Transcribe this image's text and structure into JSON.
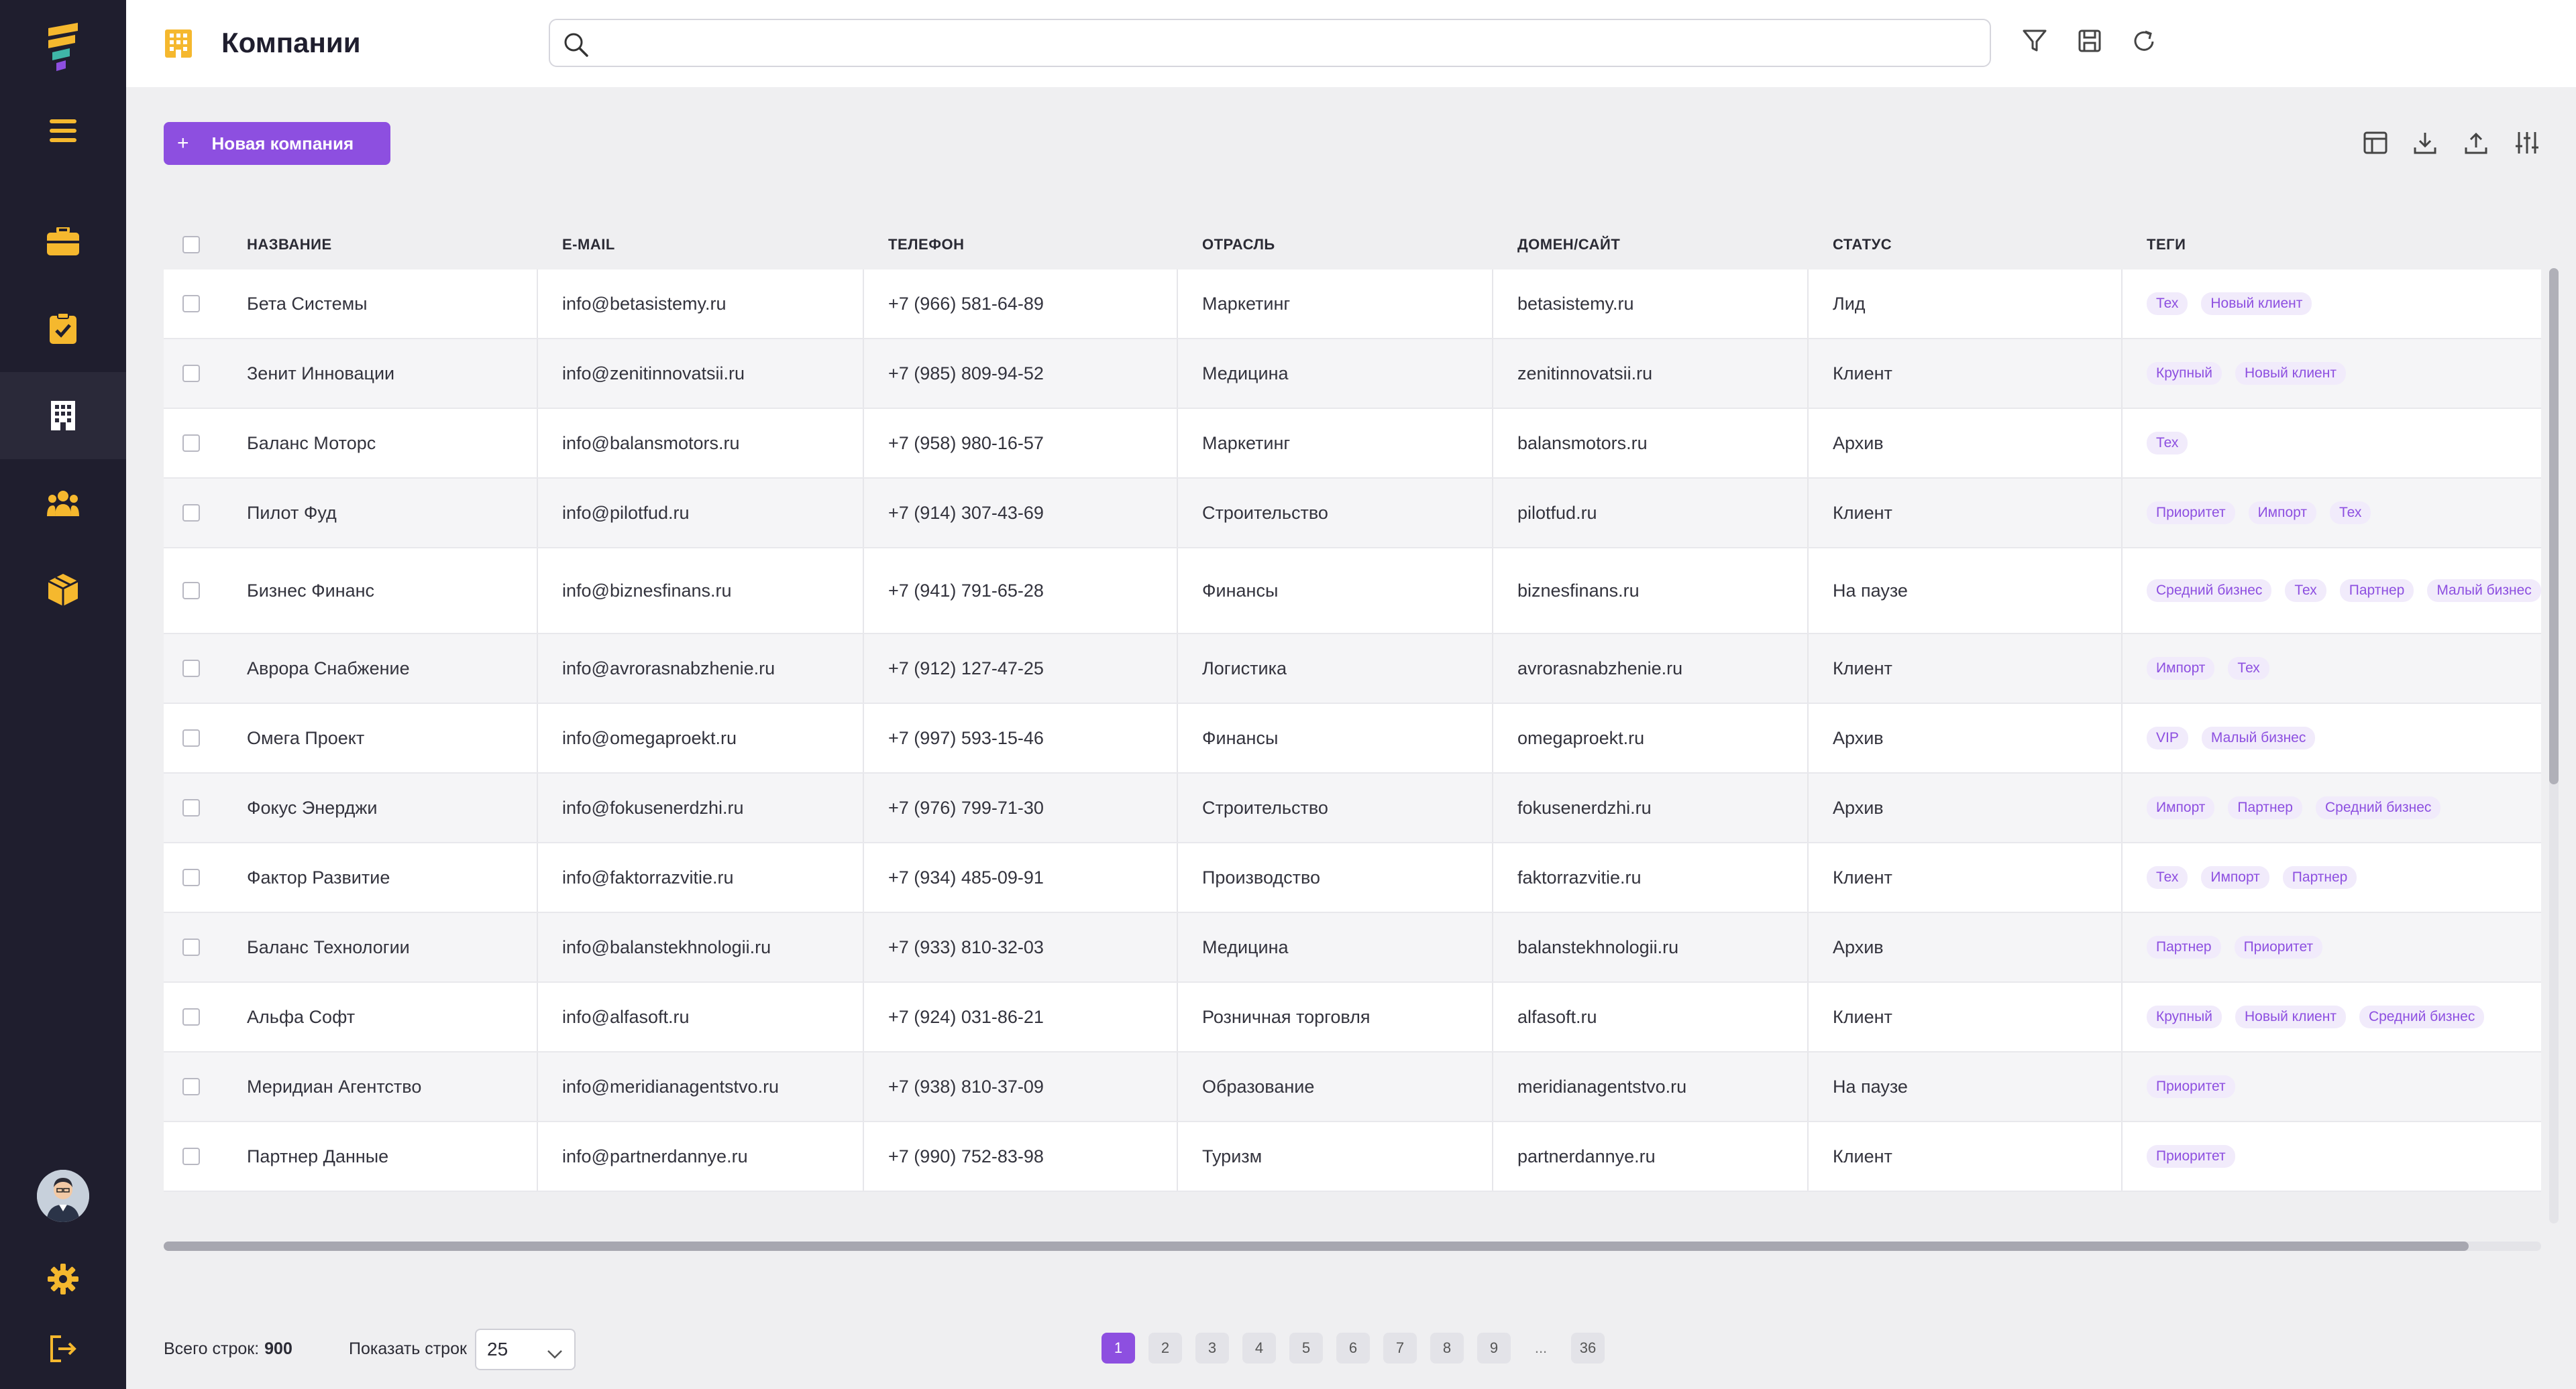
{
  "header": {
    "title": "Компании",
    "search_placeholder": ""
  },
  "toolbar": {
    "new_company_label": "Новая компания"
  },
  "table": {
    "columns": [
      "НАЗВАНИЕ",
      "E-MAIL",
      "ТЕЛЕФОН",
      "ОТРАСЛЬ",
      "ДОМЕН/САЙТ",
      "СТАТУС",
      "ТЕГИ"
    ],
    "rows": [
      {
        "name": "Бета Системы",
        "email": "info@betasistemy.ru",
        "phone": "+7 (966) 581-64-89",
        "industry": "Маркетинг",
        "domain": "betasistemy.ru",
        "status": "Лид",
        "tags": [
          "Тех",
          "Новый клиент"
        ]
      },
      {
        "name": "Зенит Инновации",
        "email": "info@zenitinnovatsii.ru",
        "phone": "+7 (985) 809-94-52",
        "industry": "Медицина",
        "domain": "zenitinnovatsii.ru",
        "status": "Клиент",
        "tags": [
          "Крупный",
          "Новый клиент"
        ]
      },
      {
        "name": "Баланс Моторс",
        "email": "info@balansmotors.ru",
        "phone": "+7 (958) 980-16-57",
        "industry": "Маркетинг",
        "domain": "balansmotors.ru",
        "status": "Архив",
        "tags": [
          "Тех"
        ]
      },
      {
        "name": "Пилот Фуд",
        "email": "info@pilotfud.ru",
        "phone": "+7 (914) 307-43-69",
        "industry": "Строительство",
        "domain": "pilotfud.ru",
        "status": "Клиент",
        "tags": [
          "Приоритет",
          "Импорт",
          "Тех"
        ]
      },
      {
        "name": "Бизнес Финанс",
        "email": "info@biznesfinans.ru",
        "phone": "+7 (941) 791-65-28",
        "industry": "Финансы",
        "domain": "biznesfinans.ru",
        "status": "На паузе",
        "tags": [
          "Средний бизнес",
          "Тех",
          "Партнер",
          "Малый бизнес"
        ]
      },
      {
        "name": "Аврора Снабжение",
        "email": "info@avrorasnabzhenie.ru",
        "phone": "+7 (912) 127-47-25",
        "industry": "Логистика",
        "domain": "avrorasnabzhenie.ru",
        "status": "Клиент",
        "tags": [
          "Импорт",
          "Тех"
        ]
      },
      {
        "name": "Омега Проект",
        "email": "info@omegaproekt.ru",
        "phone": "+7 (997) 593-15-46",
        "industry": "Финансы",
        "domain": "omegaproekt.ru",
        "status": "Архив",
        "tags": [
          "VIP",
          "Малый бизнес"
        ]
      },
      {
        "name": "Фокус Энерджи",
        "email": "info@fokusenerdzhi.ru",
        "phone": "+7 (976) 799-71-30",
        "industry": "Строительство",
        "domain": "fokusenerdzhi.ru",
        "status": "Архив",
        "tags": [
          "Импорт",
          "Партнер",
          "Средний бизнес"
        ]
      },
      {
        "name": "Фактор Развитие",
        "email": "info@faktorrazvitie.ru",
        "phone": "+7 (934) 485-09-91",
        "industry": "Производство",
        "domain": "faktorrazvitie.ru",
        "status": "Клиент",
        "tags": [
          "Тех",
          "Импорт",
          "Партнер"
        ]
      },
      {
        "name": "Баланс Технологии",
        "email": "info@balanstekhnologii.ru",
        "phone": "+7 (933) 810-32-03",
        "industry": "Медицина",
        "domain": "balanstekhnologii.ru",
        "status": "Архив",
        "tags": [
          "Партнер",
          "Приоритет"
        ]
      },
      {
        "name": "Альфа Софт",
        "email": "info@alfasoft.ru",
        "phone": "+7 (924) 031-86-21",
        "industry": "Розничная торговля",
        "domain": "alfasoft.ru",
        "status": "Клиент",
        "tags": [
          "Крупный",
          "Новый клиент",
          "Средний бизнес"
        ]
      },
      {
        "name": "Меридиан Агентство",
        "email": "info@meridianagentstvo.ru",
        "phone": "+7 (938) 810-37-09",
        "industry": "Образование",
        "domain": "meridianagentstvo.ru",
        "status": "На паузе",
        "tags": [
          "Приоритет"
        ]
      },
      {
        "name": "Партнер Данные",
        "email": "info@partnerdannye.ru",
        "phone": "+7 (990) 752-83-98",
        "industry": "Туризм",
        "domain": "partnerdannye.ru",
        "status": "Клиент",
        "tags": [
          "Приоритет"
        ]
      }
    ]
  },
  "footer": {
    "total_label": "Всего строк:",
    "total_value": "900",
    "show_rows_label": "Показать строк",
    "rows_per_page": "25",
    "pages": [
      "1",
      "2",
      "3",
      "4",
      "5",
      "6",
      "7",
      "8",
      "9",
      "...",
      "36"
    ],
    "active_page": "1"
  },
  "colors": {
    "accent": "#8d4fe0",
    "sidebar_bg": "#1f1e2e",
    "icon_yellow": "#f5b82e",
    "tag_bg": "#f1ebfb"
  },
  "icons": {
    "sidebar": [
      "logo-icon",
      "menu-icon",
      "briefcase-icon",
      "clipboard-check-icon",
      "building-icon",
      "team-icon",
      "package-icon",
      "settings-icon",
      "logout-icon"
    ],
    "header": [
      "building-icon",
      "search-icon",
      "filter-icon",
      "save-icon",
      "refresh-icon"
    ],
    "table_tools": [
      "layout-icon",
      "download-icon",
      "upload-icon",
      "sliders-icon"
    ]
  }
}
